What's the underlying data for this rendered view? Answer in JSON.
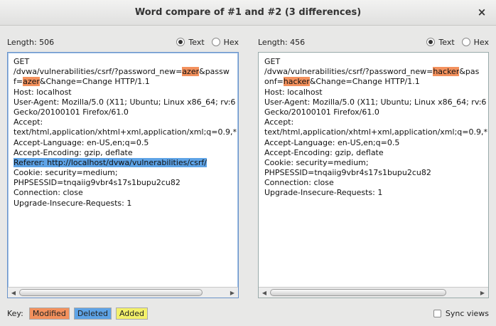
{
  "window": {
    "title": "Word compare of #1 and #2  (3 differences)",
    "close_glyph": "×"
  },
  "left": {
    "length_label": "Length: 506",
    "text_radio": "Text",
    "hex_radio": "Hex",
    "selected": "Text",
    "lines": [
      {
        "segments": [
          {
            "text": "GET"
          }
        ]
      },
      {
        "segments": [
          {
            "text": "/dvwa/vulnerabilities/csrf/?password_new="
          },
          {
            "text": "azer",
            "hl": "modified"
          },
          {
            "text": "&passw"
          }
        ]
      },
      {
        "segments": [
          {
            "text": "f="
          },
          {
            "text": "azer",
            "hl": "modified"
          },
          {
            "text": "&Change=Change HTTP/1.1"
          }
        ]
      },
      {
        "segments": [
          {
            "text": "Host: localhost"
          }
        ]
      },
      {
        "segments": [
          {
            "text": "User-Agent: Mozilla/5.0 (X11; Ubuntu; Linux x86_64; rv:6"
          }
        ]
      },
      {
        "segments": [
          {
            "text": "Gecko/20100101 Firefox/61.0"
          }
        ]
      },
      {
        "segments": [
          {
            "text": "Accept:"
          }
        ]
      },
      {
        "segments": [
          {
            "text": "text/html,application/xhtml+xml,application/xml;q=0.9,*"
          }
        ]
      },
      {
        "segments": [
          {
            "text": "Accept-Language: en-US,en;q=0.5"
          }
        ]
      },
      {
        "segments": [
          {
            "text": "Accept-Encoding: gzip, deflate"
          }
        ]
      },
      {
        "segments": [
          {
            "text": "Referer: http://localhost/dvwa/vulnerabilities/csrf/",
            "hl": "deleted"
          }
        ]
      },
      {
        "segments": [
          {
            "text": "Cookie: security=medium;"
          }
        ]
      },
      {
        "segments": [
          {
            "text": "PHPSESSID=tnqaiig9vbr4s17s1bupu2cu82"
          }
        ]
      },
      {
        "segments": [
          {
            "text": "Connection: close"
          }
        ]
      },
      {
        "segments": [
          {
            "text": "Upgrade-Insecure-Requests: 1"
          }
        ]
      }
    ]
  },
  "right": {
    "length_label": "Length: 456",
    "text_radio": "Text",
    "hex_radio": "Hex",
    "selected": "Text",
    "lines": [
      {
        "segments": [
          {
            "text": "GET"
          }
        ]
      },
      {
        "segments": [
          {
            "text": "/dvwa/vulnerabilities/csrf/?password_new="
          },
          {
            "text": "hacker",
            "hl": "modified"
          },
          {
            "text": "&pas"
          }
        ]
      },
      {
        "segments": [
          {
            "text": "onf="
          },
          {
            "text": "hacker",
            "hl": "modified"
          },
          {
            "text": "&Change=Change HTTP/1.1"
          }
        ]
      },
      {
        "segments": [
          {
            "text": "Host: localhost"
          }
        ]
      },
      {
        "segments": [
          {
            "text": "User-Agent: Mozilla/5.0 (X11; Ubuntu; Linux x86_64; rv:6"
          }
        ]
      },
      {
        "segments": [
          {
            "text": "Gecko/20100101 Firefox/61.0"
          }
        ]
      },
      {
        "segments": [
          {
            "text": "Accept:"
          }
        ]
      },
      {
        "segments": [
          {
            "text": "text/html,application/xhtml+xml,application/xml;q=0.9,*"
          }
        ]
      },
      {
        "segments": [
          {
            "text": "Accept-Language: en-US,en;q=0.5"
          }
        ]
      },
      {
        "segments": [
          {
            "text": "Accept-Encoding: gzip, deflate"
          }
        ]
      },
      {
        "segments": [
          {
            "text": "Cookie: security=medium;"
          }
        ]
      },
      {
        "segments": [
          {
            "text": "PHPSESSID=tnqaiig9vbr4s17s1bupu2cu82"
          }
        ]
      },
      {
        "segments": [
          {
            "text": "Connection: close"
          }
        ]
      },
      {
        "segments": [
          {
            "text": "Upgrade-Insecure-Requests: 1"
          }
        ]
      }
    ]
  },
  "footer": {
    "key_label": "Key:",
    "modified": "Modified",
    "deleted": "Deleted",
    "added": "Added",
    "sync_label": "Sync views"
  },
  "colors": {
    "modified": "#f3915d",
    "deleted": "#5ea3e6",
    "added": "#f3f06a"
  },
  "scroll_icons": {
    "left": "◀",
    "right": "▶"
  }
}
